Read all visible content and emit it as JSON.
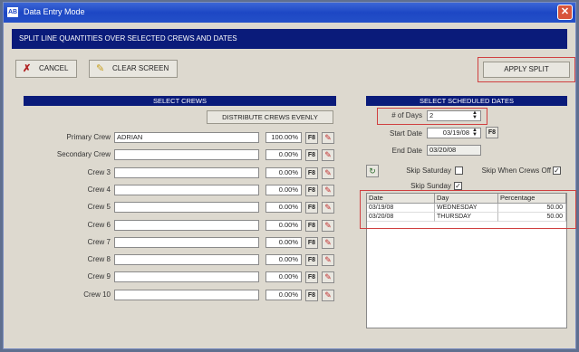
{
  "window": {
    "title": "Data Entry Mode",
    "app_icon": "AB",
    "close_glyph": "✕"
  },
  "banner": "SPLIT LINE QUANTITIES OVER SELECTED CREWS AND DATES",
  "toolbar": {
    "cancel": "CANCEL",
    "clear": "CLEAR SCREEN",
    "apply": "APPLY SPLIT"
  },
  "crews": {
    "header": "SELECT CREWS",
    "distribute": "DISTRIBUTE CREWS EVENLY",
    "f8": "F8",
    "rows": [
      {
        "label": "Primary Crew",
        "value": "ADRIAN",
        "pct": "100.00%"
      },
      {
        "label": "Secondary Crew",
        "value": "",
        "pct": "0.00%"
      },
      {
        "label": "Crew 3",
        "value": "",
        "pct": "0.00%"
      },
      {
        "label": "Crew 4",
        "value": "",
        "pct": "0.00%"
      },
      {
        "label": "Crew 5",
        "value": "",
        "pct": "0.00%"
      },
      {
        "label": "Crew 6",
        "value": "",
        "pct": "0.00%"
      },
      {
        "label": "Crew 7",
        "value": "",
        "pct": "0.00%"
      },
      {
        "label": "Crew 8",
        "value": "",
        "pct": "0.00%"
      },
      {
        "label": "Crew 9",
        "value": "",
        "pct": "0.00%"
      },
      {
        "label": "Crew 10",
        "value": "",
        "pct": "0.00%"
      }
    ]
  },
  "dates": {
    "header": "SELECT SCHEDULED DATES",
    "days_label": "# of Days",
    "days_value": "2",
    "start_label": "Start Date",
    "start_value": "03/19/08",
    "end_label": "End Date",
    "end_value": "03/20/08",
    "skip_saturday": "Skip Saturday",
    "skip_crews_off": "Skip When Crews Off",
    "skip_sunday": "Skip Sunday",
    "check_glyph": "✓",
    "columns": [
      "Date",
      "Day",
      "Percentage"
    ],
    "rows": [
      [
        "03/19/08",
        "WEDNESDAY",
        "50.00"
      ],
      [
        "03/20/08",
        "THURSDAY",
        "50.00"
      ]
    ]
  }
}
